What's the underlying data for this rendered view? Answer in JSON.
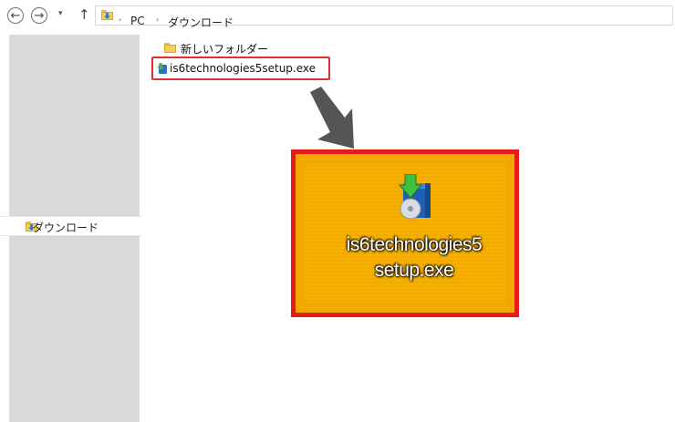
{
  "addressbar": {
    "back_icon": "back-arrow-icon",
    "forward_icon": "forward-arrow-icon",
    "recent_icon": "chevron-down-icon",
    "up_icon": "up-arrow-icon",
    "back_glyph": "←",
    "forward_glyph": "→",
    "recent_glyph": "▾",
    "up_glyph": "↑",
    "separator_glyph": "›",
    "breadcrumb": [
      "PC",
      "ダウンロード"
    ]
  },
  "navpane": {
    "selected_item": "ダウンロード"
  },
  "files": [
    {
      "name": "新しいフォルダー",
      "type": "folder"
    },
    {
      "name": "is6technologies5setup.exe",
      "type": "exe"
    }
  ],
  "desktop_icon": {
    "label_line1": "is6technologies5",
    "label_line2": "setup.exe"
  },
  "colors": {
    "highlight_border": "#e81b1b",
    "desktop_background": "#f2a800",
    "arrow": "#555555"
  }
}
